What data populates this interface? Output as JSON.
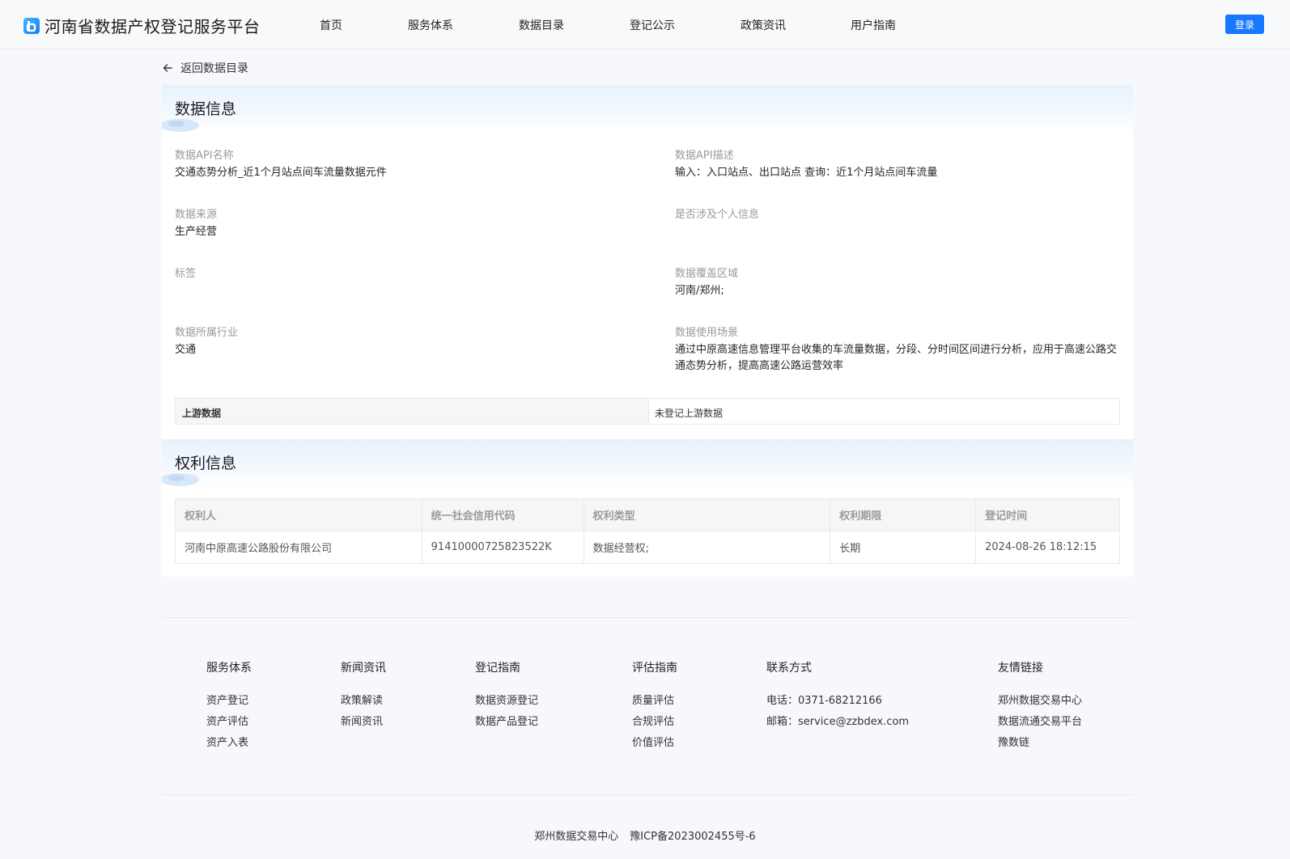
{
  "header": {
    "site_title": "河南省数据产权登记服务平台",
    "nav": [
      "首页",
      "服务体系",
      "数据目录",
      "登记公示",
      "政策资讯",
      "用户指南"
    ],
    "login_label": "登录"
  },
  "back_link": "返回数据目录",
  "data_info": {
    "title": "数据信息",
    "fields": [
      {
        "label": "数据API名称",
        "value": "交通态势分析_近1个月站点间车流量数据元件"
      },
      {
        "label": "数据API描述",
        "value": "输入：入口站点、出口站点 查询：近1个月站点间车流量"
      },
      {
        "label": "数据来源",
        "value": "生产经营"
      },
      {
        "label": "是否涉及个人信息",
        "value": ""
      },
      {
        "label": "标签",
        "value": ""
      },
      {
        "label": "数据覆盖区域",
        "value": "河南/郑州;"
      },
      {
        "label": "数据所属行业",
        "value": "交通"
      },
      {
        "label": "数据使用场景",
        "value": "通过中原高速信息管理平台收集的车流量数据，分段、分时间区间进行分析，应用于高速公路交通态势分析，提高高速公路运营效率"
      }
    ],
    "upstream": {
      "label": "上游数据",
      "value": "未登记上游数据"
    }
  },
  "rights_info": {
    "title": "权利信息",
    "columns": [
      "权利人",
      "统一社会信用代码",
      "权利类型",
      "权利期限",
      "登记时间"
    ],
    "rows": [
      [
        "河南中原高速公路股份有限公司",
        "91410000725823522K",
        "数据经营权;",
        "长期",
        "2024-08-26 18:12:15"
      ]
    ]
  },
  "footer": {
    "columns": [
      {
        "title": "服务体系",
        "links": [
          "资产登记",
          "资产评估",
          "资产入表"
        ]
      },
      {
        "title": "新闻资讯",
        "links": [
          "政策解读",
          "新闻资讯"
        ]
      },
      {
        "title": "登记指南",
        "links": [
          "数据资源登记",
          "数据产品登记"
        ]
      },
      {
        "title": "评估指南",
        "links": [
          "质量评估",
          "合规评估",
          "价值评估"
        ]
      },
      {
        "title": "联系方式",
        "links": [
          "电话：0371-68212166",
          "邮箱：service@zzbdex.com"
        ]
      },
      {
        "title": "友情链接",
        "links": [
          "郑州数据交易中心",
          "数据流通交易平台",
          "豫数链"
        ]
      }
    ],
    "copyright_org": "郑州数据交易中心",
    "icp": "豫ICP备2023002455号-6"
  },
  "colors": {
    "accent": "#1677ff",
    "background": "#f6f8fb"
  },
  "icons": {
    "back": "arrow-left-icon",
    "logo": "logo-icon"
  }
}
